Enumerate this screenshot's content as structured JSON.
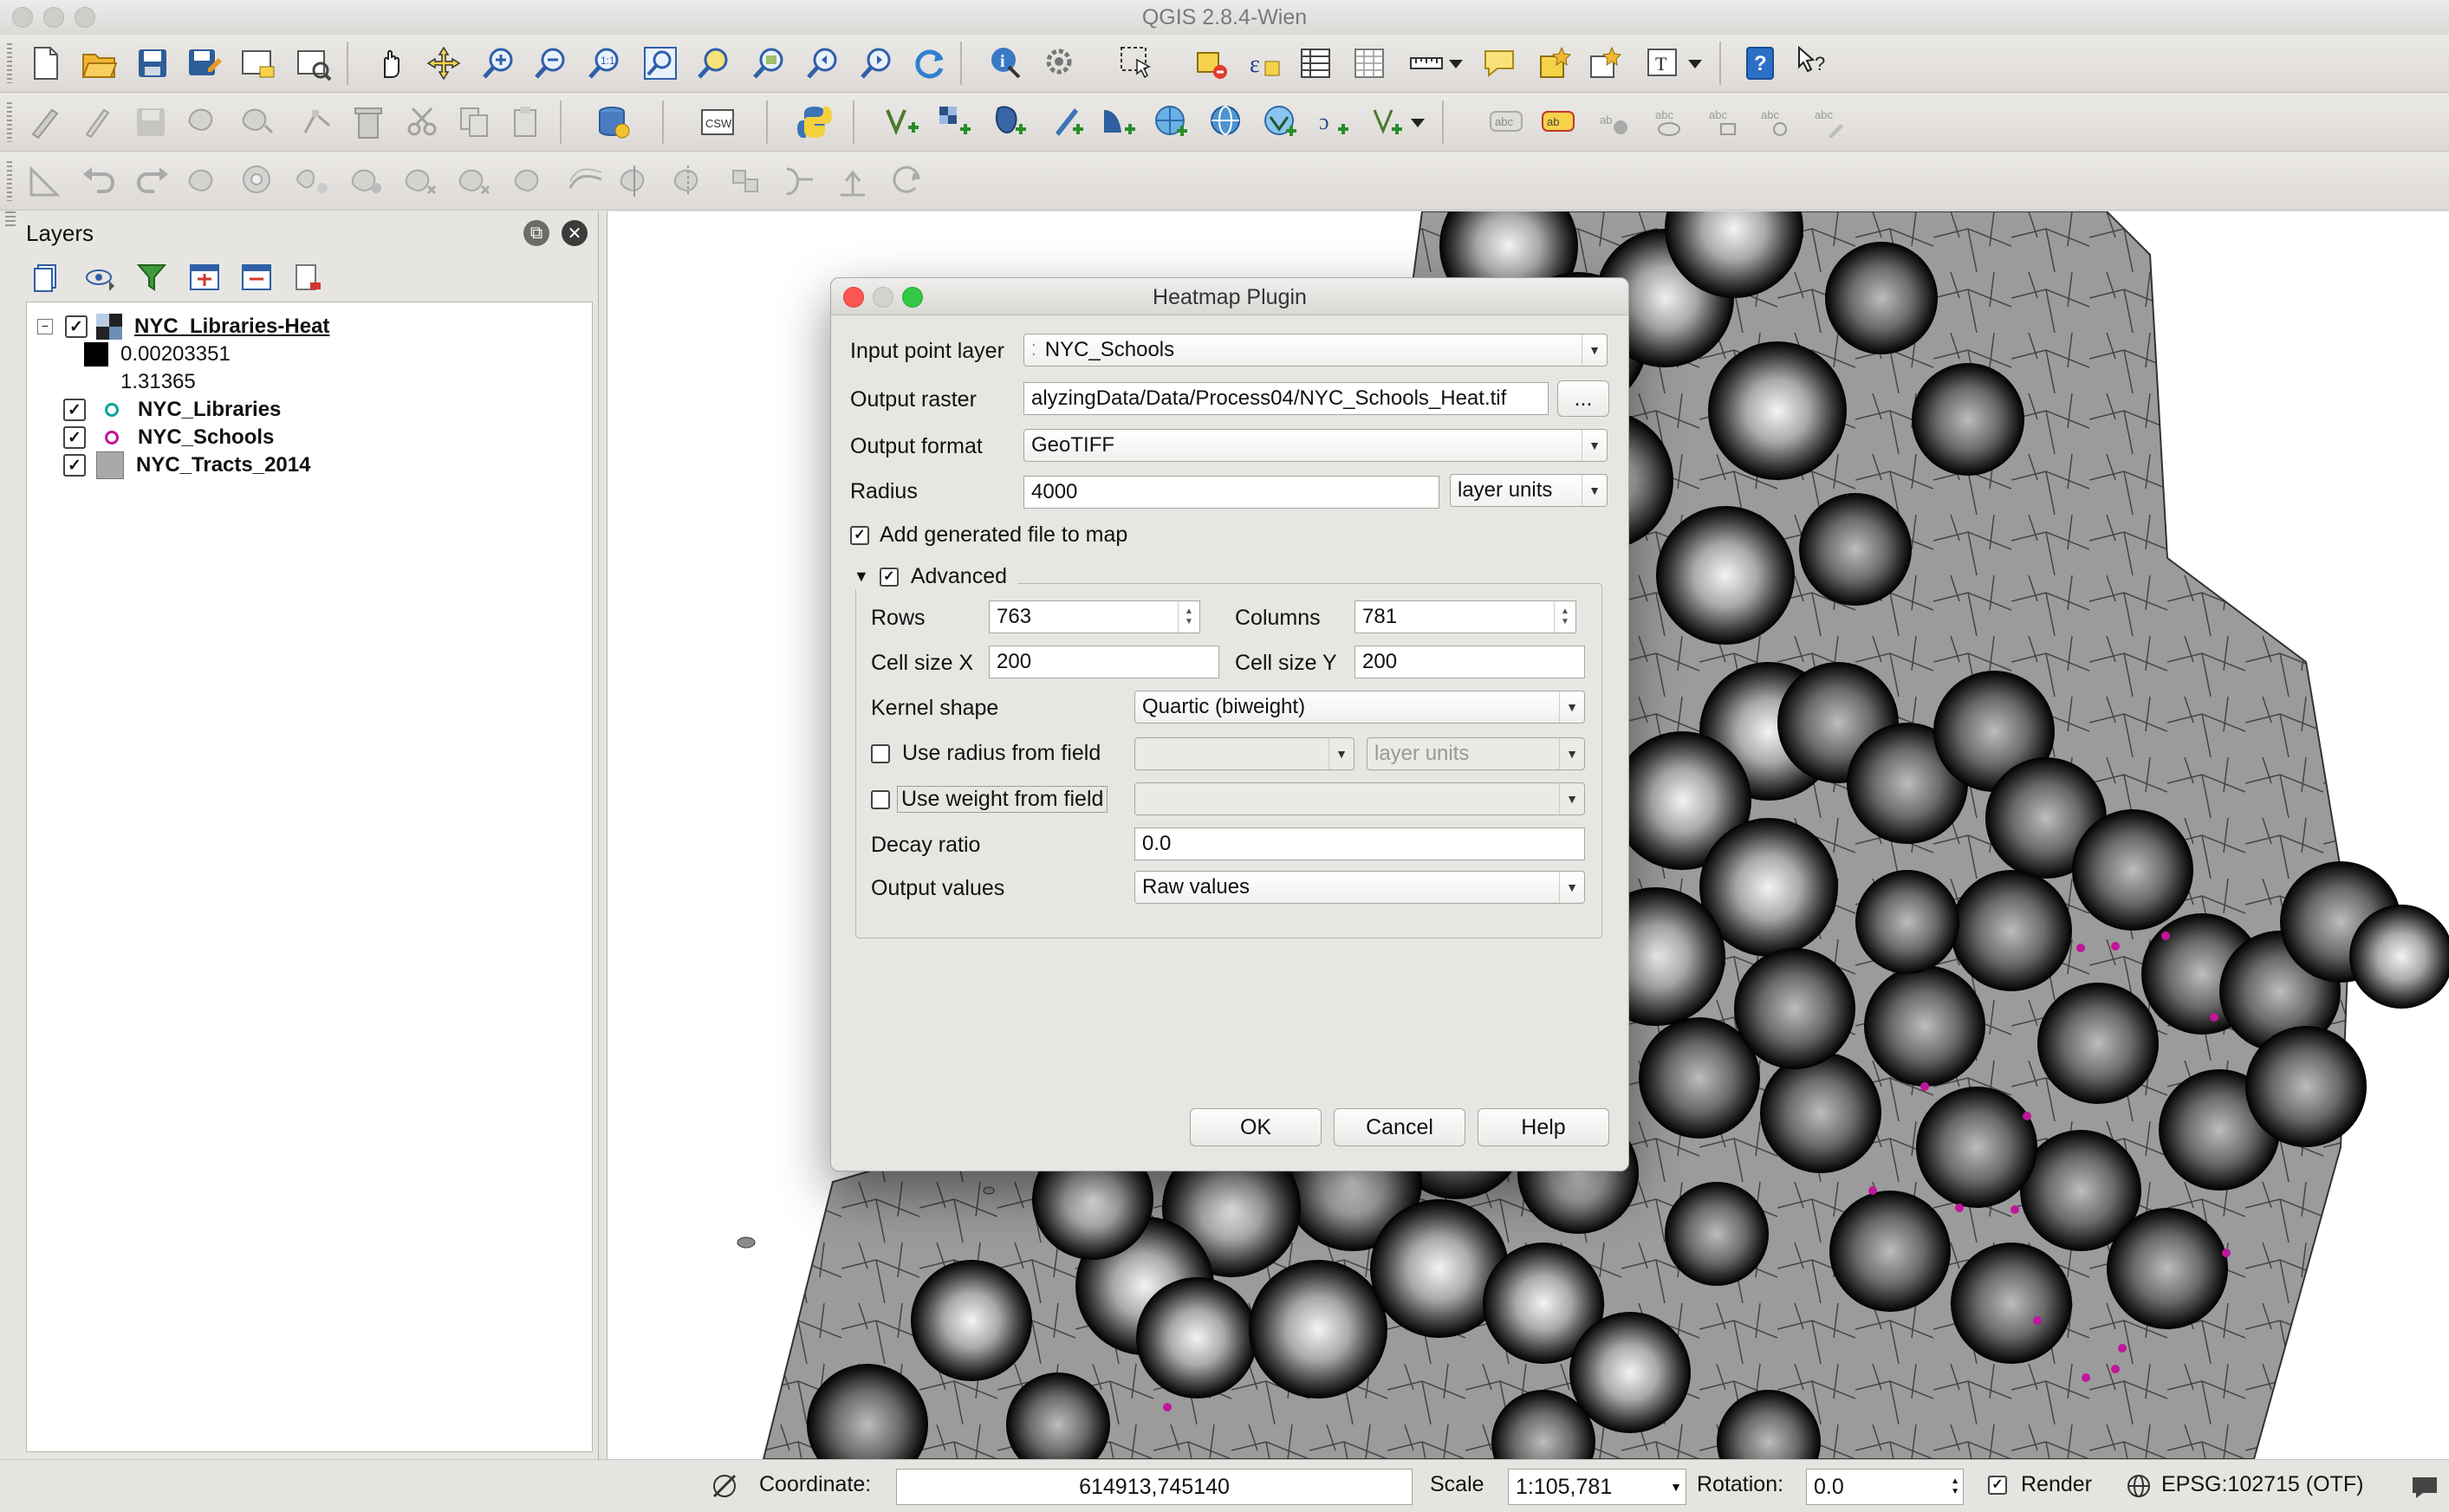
{
  "window": {
    "title": "QGIS 2.8.4-Wien"
  },
  "toolbars": {
    "row1": [
      "new-project",
      "open-project",
      "save-project",
      "save-as",
      "new-print-composer",
      "composer-manager",
      "pan",
      "pan-to-selection",
      "zoom-in",
      "zoom-out",
      "zoom-native",
      "zoom-full",
      "zoom-to-selection",
      "zoom-to-layer",
      "zoom-last",
      "zoom-next",
      "refresh",
      "identify",
      "action",
      "select-features",
      "deselect",
      "expression-select",
      "attribute-table",
      "statistics",
      "measure",
      "map-tips",
      "new-bookmark",
      "show-bookmarks",
      "text-annotation",
      "help",
      "whats-this"
    ],
    "row2": [
      "toggle-editing",
      "current-edits",
      "save-edits",
      "add-feature",
      "move-feature",
      "node-tool",
      "delete-selected",
      "cut-features",
      "copy-features",
      "paste-features",
      "database",
      "csw",
      "python",
      "add-vector",
      "add-raster",
      "add-postgis",
      "add-spatialite",
      "add-wms",
      "add-wcs",
      "add-wfs",
      "new-layer",
      "label-tools"
    ],
    "row3": [
      "digitize-tools",
      "undo",
      "redo",
      "simplify",
      "add-ring",
      "add-part",
      "fill-ring",
      "delete-ring",
      "delete-part",
      "reshape",
      "offset-curve",
      "split-features",
      "split-parts",
      "merge-features",
      "rotate-point",
      "rotate-feature"
    ]
  },
  "layers_panel": {
    "title": "Layers",
    "items": [
      {
        "name": "NYC_Libraries-Heat",
        "checked": true,
        "expanded": true,
        "legend": [
          "0.00203351",
          "1.31365"
        ]
      },
      {
        "name": "NYC_Libraries",
        "checked": true,
        "symbol_color": "#00b3a4"
      },
      {
        "name": "NYC_Schools",
        "checked": true,
        "symbol_color": "#c0169a"
      },
      {
        "name": "NYC_Tracts_2014",
        "checked": true,
        "symbol_color": "#a9a9a9"
      }
    ]
  },
  "dialog": {
    "title": "Heatmap Plugin",
    "input_point_layer": {
      "label": "Input point layer",
      "value": "NYC_Schools"
    },
    "output_raster": {
      "label": "Output raster",
      "value": "alyzingData/Data/Process04/NYC_Schools_Heat.tif",
      "browse": "..."
    },
    "output_format": {
      "label": "Output format",
      "value": "GeoTIFF"
    },
    "radius": {
      "label": "Radius",
      "value": "4000",
      "units": "layer units"
    },
    "add_to_map": {
      "label": "Add generated file to map",
      "checked": true
    },
    "advanced": {
      "label": "Advanced",
      "checked": true,
      "rows": {
        "label": "Rows",
        "value": "763"
      },
      "columns": {
        "label": "Columns",
        "value": "781"
      },
      "cell_size_x": {
        "label": "Cell size X",
        "value": "200"
      },
      "cell_size_y": {
        "label": "Cell size Y",
        "value": "200"
      },
      "kernel_shape": {
        "label": "Kernel shape",
        "value": "Quartic (biweight)"
      },
      "use_radius_from_field": {
        "label": "Use radius from field",
        "checked": false,
        "units": "layer units"
      },
      "use_weight_from_field": {
        "label": "Use weight from field",
        "checked": false
      },
      "decay_ratio": {
        "label": "Decay ratio",
        "value": "0.0"
      },
      "output_values": {
        "label": "Output values",
        "value": "Raw values"
      }
    },
    "buttons": {
      "ok": "OK",
      "cancel": "Cancel",
      "help": "Help"
    }
  },
  "statusbar": {
    "coordinate_label": "Coordinate:",
    "coordinate_value": "614913,745140",
    "scale_label": "Scale",
    "scale_value": "1:105,781",
    "rotation_label": "Rotation:",
    "rotation_value": "0.0",
    "render_label": "Render",
    "render_checked": true,
    "crs": "EPSG:102715 (OTF)"
  },
  "colors": {
    "close_red": "#fc5753",
    "minimize_gray": "#d4d2cf",
    "maximize_green": "#33c748",
    "tract_gray": "#9b9b9b",
    "school_magenta": "#c0169a"
  }
}
